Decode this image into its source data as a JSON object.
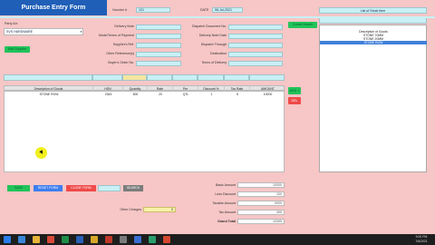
{
  "header": {
    "title": "Purchase Entry Form",
    "voucher_label": "Voucher #",
    "voucher_value": "121",
    "date_label": "DATE",
    "date_value": "06-Jul-2021"
  },
  "stock_list": {
    "label": "List of Stock Item",
    "items": [
      "Description of Goods",
      "STONE 70MM",
      "STONE 20MM",
      "STONE ROW"
    ],
    "selected": "STONE ROW"
  },
  "party": {
    "label": "Party A/c",
    "value": "SVS HARDWARE",
    "add_supplier": "Add Supplier"
  },
  "create_master": "Create Master",
  "left_fields": [
    "Delivery Note",
    "Mode/Terms of Payment",
    "Supplier's Ref.",
    "Other Reference(s)",
    "Buyer's Order No."
  ],
  "right_fields": [
    "Dispatch Document No.",
    "Delivery Note Date",
    "Dispatch Through",
    "Destination",
    "Terms of Delivery"
  ],
  "grid": {
    "columns": [
      "Description of Goods",
      "HSN",
      "Quantity",
      "Rate",
      "Per",
      "Discount %",
      "Tax Rate",
      "AMOUNT"
    ],
    "rows": [
      [
        "STONE ROW",
        "2343",
        "500",
        "20",
        "QTL",
        "1",
        "5",
        "10000"
      ]
    ],
    "add_label": "ADD >",
    "del_label": "DEL"
  },
  "buttons": {
    "save": "SAVE",
    "reset": "RESET FORM",
    "close": "CLOSE FORM",
    "search": "SEARCH"
  },
  "other_charges": {
    "label": "Other Charges",
    "value": "0"
  },
  "totals": [
    {
      "label": "Basic Amount",
      "value": "10000"
    },
    {
      "label": "Less Discount",
      "value": "100"
    },
    {
      "label": "Taxable Amount",
      "value": "9900"
    },
    {
      "label": "Tax Amount",
      "value": "495"
    },
    {
      "label": "Grand Total",
      "value": "10395"
    }
  ],
  "taskbar": {
    "time": "9:00 PM",
    "date": "7/6/2021"
  },
  "colors": {
    "background": "#f7c6c6",
    "field": "#c8f0f5",
    "title": "#1f5fb8",
    "save": "#22c35a",
    "reset": "#3f7ff0",
    "close": "#ef4a4a",
    "add": "#22c35a",
    "del": "#ef4a4a",
    "quantity_highlight": "#f5e6a0",
    "selected_row": "#3f80d8"
  }
}
